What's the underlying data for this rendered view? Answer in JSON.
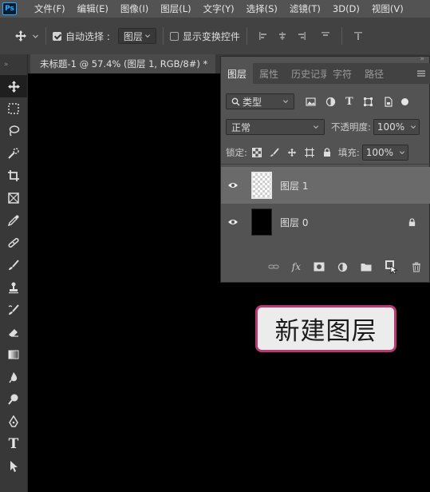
{
  "app": {
    "logo": "Ps"
  },
  "menu": [
    "文件(F)",
    "编辑(E)",
    "图像(I)",
    "图层(L)",
    "文字(Y)",
    "选择(S)",
    "滤镜(T)",
    "3D(D)",
    "视图(V)"
  ],
  "options": {
    "move_icon": "move-icon",
    "auto_select_label": "自动选择 :",
    "auto_select_checked": true,
    "auto_select_target": "图层",
    "show_transform_label": "显示变换控件",
    "show_transform_checked": false
  },
  "document": {
    "tab_title": "未标题-1 @ 57.4% (图层 1, RGB/8#) *"
  },
  "panel": {
    "tabs": [
      "图层",
      "属性",
      "历史记录",
      "字符",
      "路径"
    ],
    "active_tab": "图层",
    "filter_label": "类型",
    "blend_mode": "正常",
    "opacity_label": "不透明度:",
    "opacity_value": "100%",
    "lock_label": "锁定:",
    "fill_label": "填充:",
    "fill_value": "100%",
    "layers": [
      {
        "name": "图层 1",
        "visible": true,
        "selected": true,
        "locked": false,
        "thumb": "transparent"
      },
      {
        "name": "图层 0",
        "visible": true,
        "selected": false,
        "locked": true,
        "thumb": "black"
      }
    ],
    "footer_icons": [
      "link-icon",
      "fx-icon",
      "mask-icon",
      "adjustment-icon",
      "group-folder-icon",
      "new-layer-icon",
      "trash-icon"
    ],
    "fx_text": "fx"
  },
  "caption": "新建图层",
  "tools": [
    "move-tool-icon",
    "marquee-tool-icon",
    "lasso-tool-icon",
    "quick-select-tool-icon",
    "crop-tool-icon",
    "frame-tool-icon",
    "eyedropper-tool-icon",
    "healing-tool-icon",
    "brush-tool-icon",
    "stamp-tool-icon",
    "history-brush-tool-icon",
    "eraser-tool-icon",
    "gradient-tool-icon",
    "blur-tool-icon",
    "dodge-tool-icon",
    "pen-tool-icon",
    "type-tool-icon",
    "path-select-tool-icon"
  ],
  "type_tool_glyph": "T"
}
